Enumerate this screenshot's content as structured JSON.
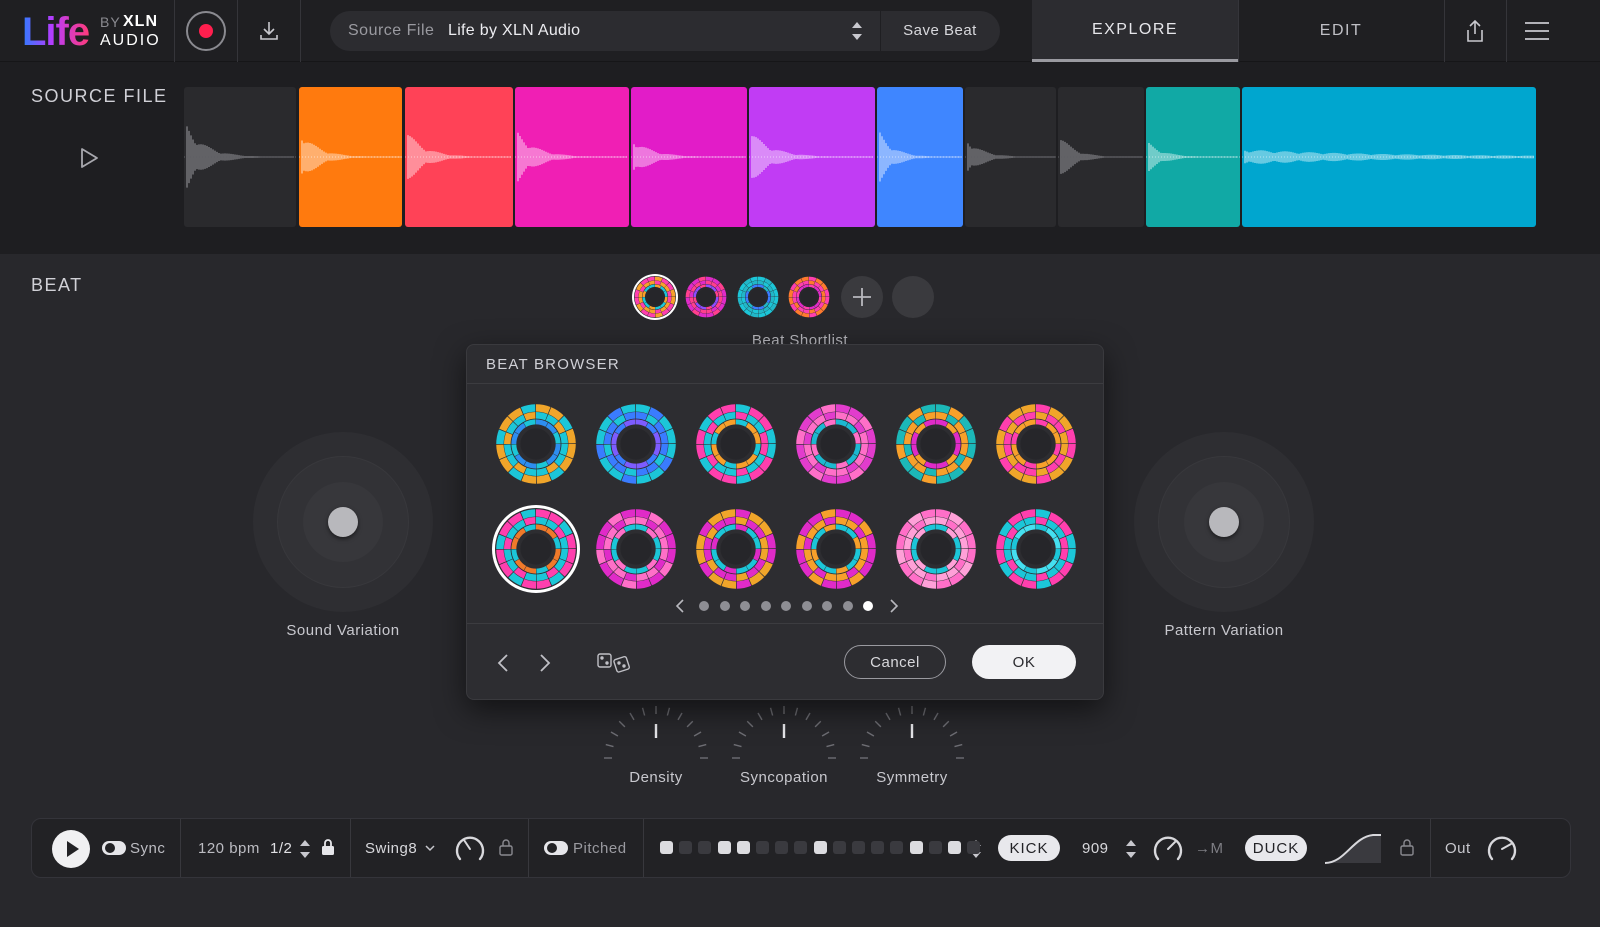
{
  "app": {
    "logo": {
      "life": "Life",
      "by": "BY",
      "xln": "XLN",
      "audio": "AUDIO"
    }
  },
  "topbar": {
    "source_label": "Source File",
    "source_value": "Life by XLN Audio",
    "save_label": "Save Beat",
    "tabs": [
      {
        "label": "EXPLORE",
        "active": true
      },
      {
        "label": "EDIT",
        "active": false
      }
    ]
  },
  "source": {
    "title": "SOURCE FILE",
    "segments": [
      {
        "color": "#2a2a2d",
        "amp": 0.45
      },
      {
        "color": "#ff7a0e",
        "amp": 0.35
      },
      {
        "color": "#ff4257",
        "amp": 0.35
      },
      {
        "color": "#f01fb4",
        "amp": 0.35
      },
      {
        "color": "#e21cc8",
        "amp": 0.25
      },
      {
        "color": "#c13cf4",
        "amp": 0.35
      },
      {
        "color": "#3f86ff",
        "amp": 0.35
      },
      {
        "color": "#2a2a2d",
        "amp": 0.25
      },
      {
        "color": "#2a2a2d",
        "amp": 0.3
      },
      {
        "color": "#11a9a5",
        "amp": 0.2
      },
      {
        "color": "#00a6cf",
        "amp": 0.18
      }
    ]
  },
  "beat": {
    "title": "BEAT",
    "shortlist_label": "Beat Shortlist",
    "shortlist": [
      {
        "outer": "#ff3fae",
        "inner": "#1cc6d8",
        "ring": "#f7a02b",
        "selected": true
      },
      {
        "outer": "#e02bc8",
        "inner": "#8e4cff",
        "ring": "#ff3f8e",
        "selected": false
      },
      {
        "outer": "#1cc6d8",
        "inner": "#3a7cff",
        "ring": "#21b7c8",
        "selected": false
      },
      {
        "outer": "#ff7a2e",
        "inner": "#e02bc8",
        "ring": "#ff3fae",
        "selected": false
      }
    ],
    "sound_variation_label": "Sound Variation",
    "pattern_variation_label": "Pattern Variation",
    "dials": [
      {
        "label": "Density"
      },
      {
        "label": "Syncopation"
      },
      {
        "label": "Symmetry"
      }
    ]
  },
  "browser": {
    "title": "BEAT BROWSER",
    "cancel_label": "Cancel",
    "ok_label": "OK",
    "page_count": 9,
    "active_page": 9,
    "items": [
      {
        "outer": "#f0a52a",
        "mid": "#1cc6d8",
        "inner": "#2d8ef0",
        "selected": false
      },
      {
        "outer": "#1cc6d8",
        "mid": "#3a7cff",
        "inner": "#7d5cff",
        "selected": false
      },
      {
        "outer": "#ff3fae",
        "mid": "#1cc6d8",
        "inner": "#f7a02b",
        "selected": false
      },
      {
        "outer": "#e23ccd",
        "mid": "#ff6fc8",
        "inner": "#1cb8d0",
        "selected": false
      },
      {
        "outer": "#1cb8b8",
        "mid": "#f7a02b",
        "inner": "#e02bc8",
        "selected": false
      },
      {
        "outer": "#f0a52a",
        "mid": "#ff3fae",
        "inner": "#f7a02b",
        "selected": false
      },
      {
        "outer": "#ff3fae",
        "mid": "#1cc6d8",
        "inner": "#f07a2a",
        "selected": true
      },
      {
        "outer": "#e02bc8",
        "mid": "#ff6fc8",
        "inner": "#1cc6d8",
        "selected": false
      },
      {
        "outer": "#f0a52a",
        "mid": "#e02bc8",
        "inner": "#1cc6d8",
        "selected": false
      },
      {
        "outer": "#e02bc8",
        "mid": "#f7a02b",
        "inner": "#1cc6d8",
        "selected": false
      },
      {
        "outer": "#ff6fc8",
        "mid": "#ffa0d8",
        "inner": "#1cc6d8",
        "selected": false
      },
      {
        "outer": "#ff3fae",
        "mid": "#1cc6d8",
        "inner": "#45e0f0",
        "selected": false
      }
    ]
  },
  "transport": {
    "sync_label": "Sync",
    "bpm_label": "120 bpm",
    "division_label": "1/2",
    "swing_label": "Swing8",
    "pitched_label": "Pitched",
    "steps": [
      true,
      false,
      false,
      true,
      true,
      false,
      false,
      false,
      true,
      false,
      false,
      false,
      false,
      true,
      false,
      true,
      false
    ],
    "kick_label": "KICK",
    "kit_label": "909",
    "to_m_label": "→M",
    "duck_label": "DUCK",
    "out_label": "Out"
  },
  "colors": {
    "accent_record": "#ff1f4e",
    "bg": "#28282c"
  }
}
